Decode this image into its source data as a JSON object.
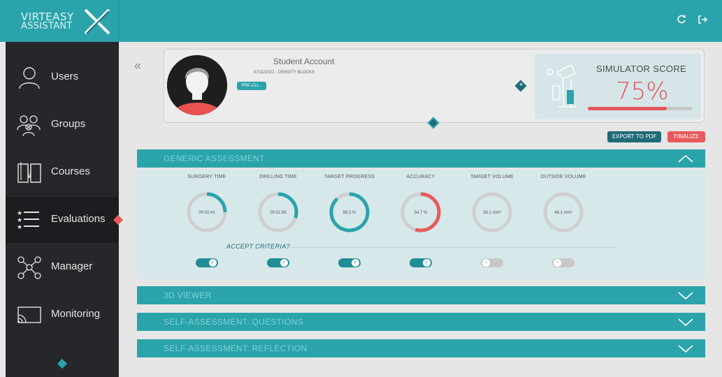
{
  "app": {
    "logo_line1": "VIRTEASY",
    "logo_line2": "ASSISTANT"
  },
  "sidebar": {
    "items": [
      {
        "label": "Users",
        "icon": "user-icon"
      },
      {
        "label": "Groups",
        "icon": "group-icon"
      },
      {
        "label": "Courses",
        "icon": "book-icon"
      },
      {
        "label": "Evaluations",
        "icon": "list-icon"
      },
      {
        "label": "Manager",
        "icon": "network-icon"
      },
      {
        "label": "Monitoring",
        "icon": "cast-icon"
      }
    ],
    "active": "Evaluations"
  },
  "student": {
    "name": "Student Account",
    "subtitle": "07/11/2022 - DENSITY BLOCKS",
    "tag": "PRE-CLI..."
  },
  "score": {
    "title": "SIMULATOR SCORE",
    "value": "75%",
    "progress": 0.75
  },
  "buttons": {
    "export": "EXPORT TO PDF",
    "finalize": "FINALIZE"
  },
  "sections": {
    "generic": "GENERIC ASSESSMENT",
    "viewer": "3D VIEWER",
    "questions": "SELF-ASSESSMENT: QUESTIONS",
    "reflection": "SELF-ASSESSMENT: REFLECTION"
  },
  "metrics": [
    {
      "name": "SURGERY TIME",
      "value": "00:02:41",
      "fraction": 0.25,
      "color": "#2aa3ab",
      "accepted": true
    },
    {
      "name": "DRILLING TIME",
      "value": "00:01:56",
      "fraction": 0.3,
      "color": "#2aa3ab",
      "accepted": true
    },
    {
      "name": "TARGET PROGRESS",
      "value": "88.2 %",
      "fraction": 0.882,
      "color": "#2aa3ab",
      "accepted": true
    },
    {
      "name": "ACCURACY",
      "value": "54.7 %",
      "fraction": 0.547,
      "color": "#e85a5a",
      "accepted": true
    },
    {
      "name": "TARGET VOLUME",
      "value": "58.1 mm³",
      "fraction": 0,
      "color": "#2aa3ab",
      "accepted": false
    },
    {
      "name": "OUTSIDE VOLUME",
      "value": "48.1 mm³",
      "fraction": 0,
      "color": "#2aa3ab",
      "accepted": false
    }
  ],
  "accept_label": "ACCEPT CRITERIA?",
  "colors": {
    "accent": "#2aa3ab",
    "dark": "#25272b",
    "alert": "#e85a5a"
  }
}
